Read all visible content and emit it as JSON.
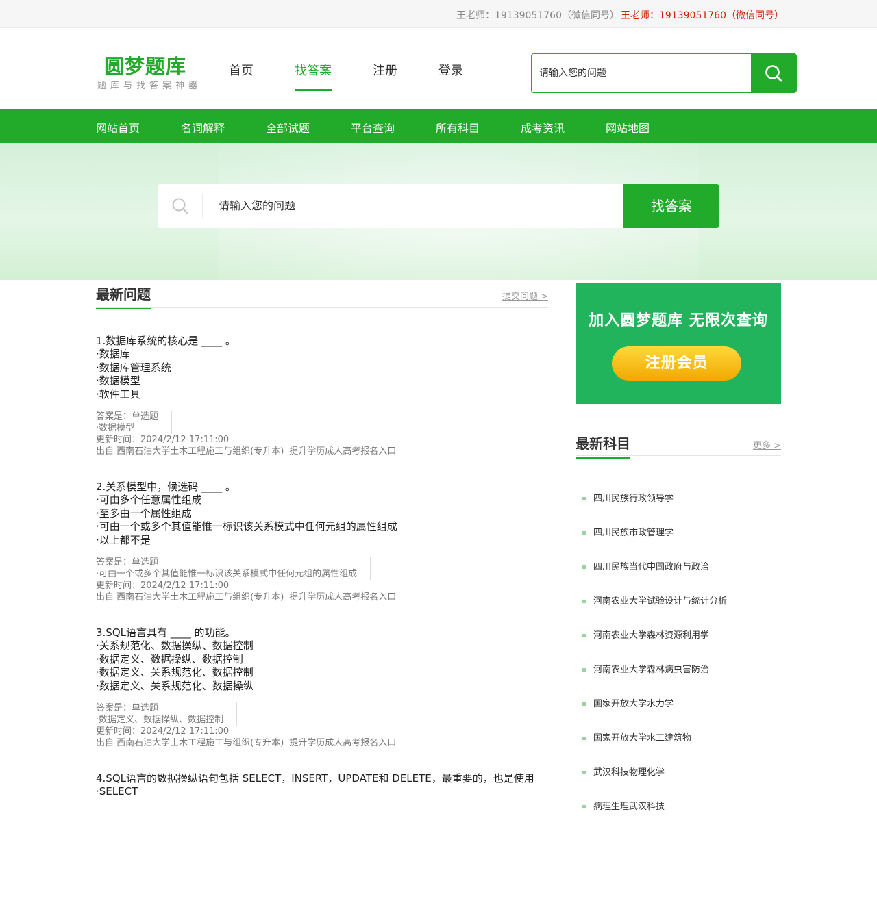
{
  "topbar": {
    "contact_gray": "王老师：19139051760（微信同号）",
    "contact_red": "王老师：19139051760（微信同号）"
  },
  "header": {
    "logo_title": "圆梦题库",
    "logo_subtitle": "题库与找答案神器",
    "nav": [
      "首页",
      "找答案",
      "注册",
      "登录"
    ],
    "active_nav": "找答案",
    "search_placeholder": "请输入您的问题"
  },
  "green_nav": [
    "网站首页",
    "名词解释",
    "全部试题",
    "平台查询",
    "所有科目",
    "成考资讯",
    "网站地图"
  ],
  "banner": {
    "search_placeholder": "请输入您的问题",
    "search_button": "找答案"
  },
  "latest_questions": {
    "title": "最新问题",
    "more": "提交问题 >",
    "items": [
      {
        "question": "1.数据库系统的核心是 ____ 。",
        "options": [
          "·数据库",
          "·数据库管理系统",
          "·数据模型",
          "·软件工具"
        ],
        "answer_label": "答案是：单选题",
        "answer": "·数据模型",
        "updated": "更新时间：2024/2/12 17:11:00",
        "source": "出自 西南石油大学土木工程施工与组织(专升本)",
        "link": "提升学历成人高考报名入口"
      },
      {
        "question": "2.关系模型中，候选码 ____ 。",
        "options": [
          "·可由多个任意属性组成",
          "·至多由一个属性组成",
          "·可由一个或多个其值能惟一标识该关系模式中任何元组的属性组成",
          "·以上都不是"
        ],
        "answer_label": "答案是：单选题",
        "answer": "·可由一个或多个其值能惟一标识该关系模式中任何元组的属性组成",
        "updated": "更新时间：2024/2/12 17:11:00",
        "source": "出自 西南石油大学土木工程施工与组织(专升本)",
        "link": "提升学历成人高考报名入口"
      },
      {
        "question": "3.SQL语言具有 ____ 的功能。",
        "options": [
          "·关系规范化、数据操纵、数据控制",
          "·数据定义、数据操纵、数据控制",
          "·数据定义、关系规范化、数据控制",
          "·数据定义、关系规范化、数据操纵"
        ],
        "answer_label": "答案是：单选题",
        "answer": "·数据定义、数据操纵、数据控制",
        "updated": "更新时间：2024/2/12 17:11:00",
        "source": "出自 西南石油大学土木工程施工与组织(专升本)",
        "link": "提升学历成人高考报名入口"
      },
      {
        "question": "4.SQL语言的数据操纵语句包括 SELECT，INSERT，UPDATE和 DELETE，最重要的，也是使用",
        "options": [
          "·SELECT"
        ],
        "answer_label": "",
        "answer": "",
        "updated": "",
        "source": "",
        "link": ""
      }
    ]
  },
  "promo": {
    "title": "加入圆梦题库  无限次查询",
    "button": "注册会员"
  },
  "latest_subjects": {
    "title": "最新科目",
    "more": "更多 >",
    "items": [
      "四川民族行政领导学",
      "四川民族市政管理学",
      "四川民族当代中国政府与政治",
      "河南农业大学试验设计与统计分析",
      "河南农业大学森林资源利用学",
      "河南农业大学森林病虫害防治",
      "国家开放大学水力学",
      "国家开放大学水工建筑物",
      "武汉科技物理化学",
      "病理生理武汉科技"
    ]
  },
  "colors": {
    "brand_green": "#22aa2a",
    "promo_green": "#22b45c",
    "accent_red": "#d81e06",
    "button_gold": "#f5b800"
  }
}
